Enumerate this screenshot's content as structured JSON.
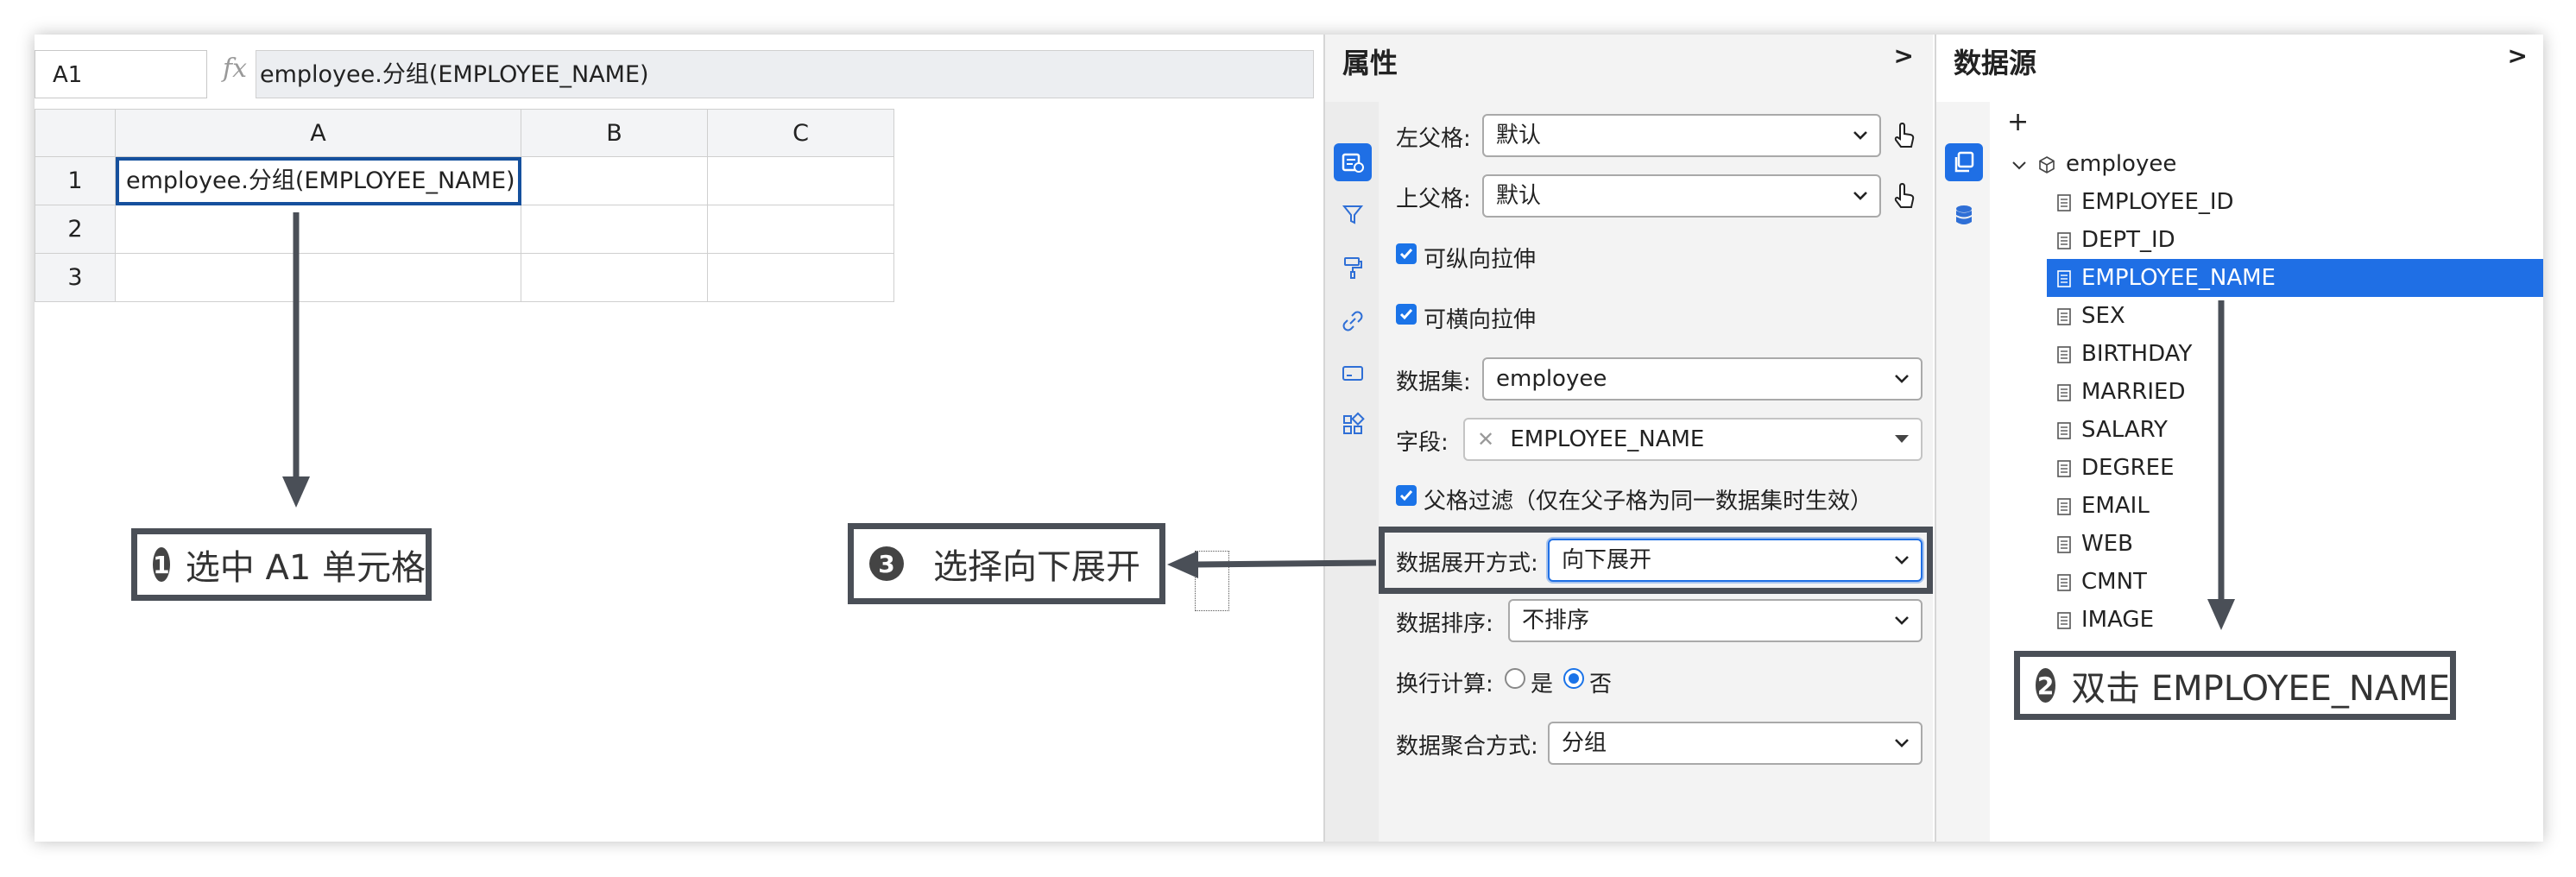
{
  "sheet": {
    "name_box": "A1",
    "fx_label": "fx",
    "formula": "employee.分组(EMPLOYEE_NAME)",
    "columns": [
      "A",
      "B",
      "C"
    ],
    "rows": [
      "1",
      "2",
      "3"
    ],
    "cell_a1": "employee.分组(EMPLOYEE_NAME)"
  },
  "annotations": {
    "step1": {
      "num": "1",
      "text": "选中 A1 单元格"
    },
    "step2": {
      "num": "2",
      "text": "双击 EMPLOYEE_NAME"
    },
    "step3": {
      "num": "3",
      "text": "选择向下展开"
    }
  },
  "props": {
    "title": "属性",
    "collapse": ">",
    "left_parent_label": "左父格:",
    "left_parent_value": "默认",
    "top_parent_label": "上父格:",
    "top_parent_value": "默认",
    "vertical_stretch": "可纵向拉伸",
    "horizontal_stretch": "可横向拉伸",
    "dataset_label": "数据集:",
    "dataset_value": "employee",
    "field_label": "字段:",
    "field_value": "EMPLOYEE_NAME",
    "parent_filter": "父格过滤（仅在父子格为同一数据集时生效）",
    "expand_label": "数据展开方式:",
    "expand_value": "向下展开",
    "sort_label": "数据排序:",
    "sort_value": "不排序",
    "wrap_label": "换行计算:",
    "wrap_yes": "是",
    "wrap_no": "否",
    "agg_label": "数据聚合方式:",
    "agg_value": "分组",
    "colors": {
      "accent": "#1f6fe5"
    }
  },
  "datasource": {
    "title": "数据源",
    "collapse": ">",
    "add": "+",
    "dataset": "employee",
    "fields": [
      "EMPLOYEE_ID",
      "DEPT_ID",
      "EMPLOYEE_NAME",
      "SEX",
      "BIRTHDAY",
      "MARRIED",
      "SALARY",
      "DEGREE",
      "EMAIL",
      "WEB",
      "CMNT",
      "IMAGE"
    ],
    "selected_field": "EMPLOYEE_NAME"
  }
}
